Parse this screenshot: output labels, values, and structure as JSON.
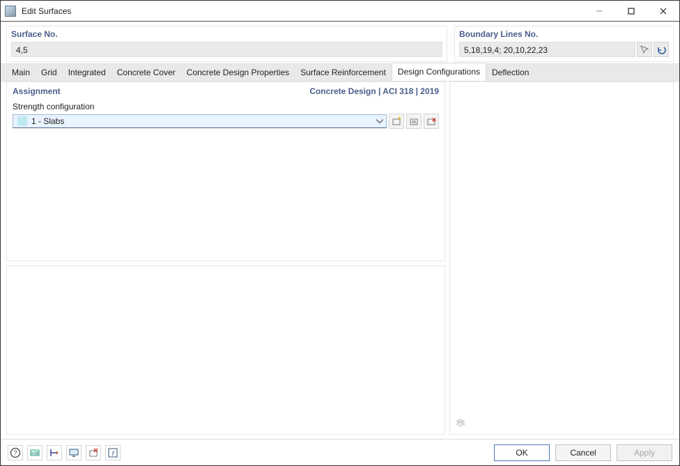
{
  "window": {
    "title": "Edit Surfaces"
  },
  "header": {
    "surfaceNo": {
      "label": "Surface No.",
      "value": "4,5"
    },
    "boundaryLinesNo": {
      "label": "Boundary Lines No.",
      "value": "5,18,19,4; 20,10,22,23"
    }
  },
  "tabs": [
    {
      "label": "Main"
    },
    {
      "label": "Grid"
    },
    {
      "label": "Integrated"
    },
    {
      "label": "Concrete Cover"
    },
    {
      "label": "Concrete Design Properties"
    },
    {
      "label": "Surface Reinforcement"
    },
    {
      "label": "Design Configurations",
      "active": true
    },
    {
      "label": "Deflection"
    }
  ],
  "assignment": {
    "title": "Assignment",
    "subtitle": "Concrete Design | ACI 318 | 2019",
    "strengthConfigLabel": "Strength configuration",
    "strengthConfigValue": "1 - Slabs"
  },
  "footer": {
    "ok": "OK",
    "cancel": "Cancel",
    "apply": "Apply"
  }
}
